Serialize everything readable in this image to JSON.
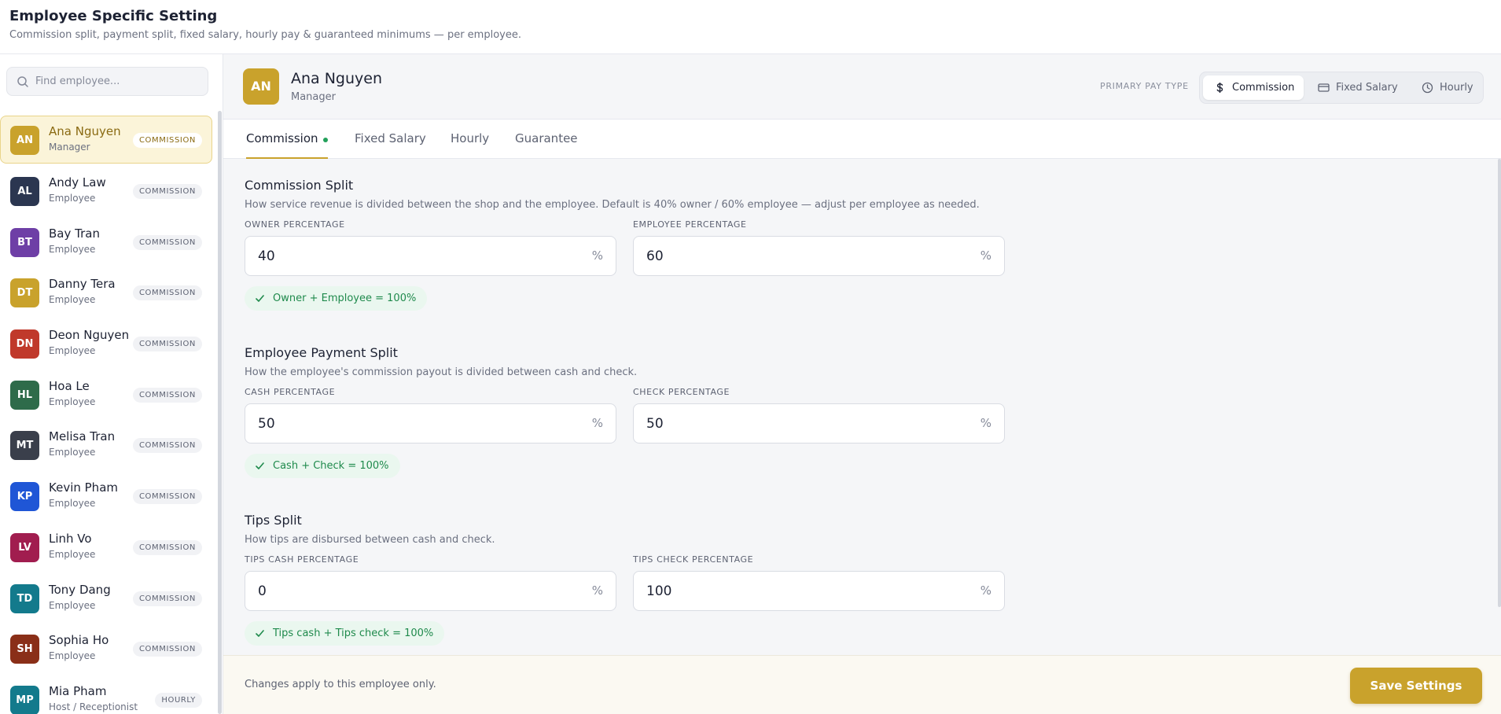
{
  "page": {
    "title": "Employee Specific Setting",
    "subtitle": "Commission split, payment split, fixed salary, hourly pay & guaranteed minimums — per employee."
  },
  "sidebar": {
    "search_placeholder": "Find employee...",
    "employees": [
      {
        "initials": "AN",
        "name": "Ana Nguyen",
        "role": "Manager",
        "badge": "COMMISSION",
        "color": "#c9a22c",
        "active": true
      },
      {
        "initials": "AL",
        "name": "Andy Law",
        "role": "Employee",
        "badge": "COMMISSION",
        "color": "#2b3650"
      },
      {
        "initials": "BT",
        "name": "Bay Tran",
        "role": "Employee",
        "badge": "COMMISSION",
        "color": "#6e3fa6"
      },
      {
        "initials": "DT",
        "name": "Danny Tera",
        "role": "Employee",
        "badge": "COMMISSION",
        "color": "#c9a22c"
      },
      {
        "initials": "DN",
        "name": "Deon Nguyen",
        "role": "Employee",
        "badge": "COMMISSION",
        "color": "#c0392b"
      },
      {
        "initials": "HL",
        "name": "Hoa Le",
        "role": "Employee",
        "badge": "COMMISSION",
        "color": "#2e6b4a"
      },
      {
        "initials": "MT",
        "name": "Melisa Tran",
        "role": "Employee",
        "badge": "COMMISSION",
        "color": "#3a3f4b"
      },
      {
        "initials": "KP",
        "name": "Kevin Pham",
        "role": "Employee",
        "badge": "COMMISSION",
        "color": "#1f56d6"
      },
      {
        "initials": "LV",
        "name": "Linh Vo",
        "role": "Employee",
        "badge": "COMMISSION",
        "color": "#a11d4f"
      },
      {
        "initials": "TD",
        "name": "Tony Dang",
        "role": "Employee",
        "badge": "COMMISSION",
        "color": "#137a8c"
      },
      {
        "initials": "SH",
        "name": "Sophia Ho",
        "role": "Employee",
        "badge": "COMMISSION",
        "color": "#8a2f18"
      },
      {
        "initials": "MP",
        "name": "Mia Pham",
        "role": "Host / Receptionist",
        "badge": "HOURLY",
        "color": "#137a8c"
      }
    ]
  },
  "employee": {
    "initials": "AN",
    "name": "Ana Nguyen",
    "role": "Manager"
  },
  "pay_type": {
    "label": "PRIMARY PAY TYPE",
    "options": [
      {
        "label": "Commission",
        "icon": "dollar-icon",
        "active": true
      },
      {
        "label": "Fixed Salary",
        "icon": "card-icon",
        "active": false
      },
      {
        "label": "Hourly",
        "icon": "clock-icon",
        "active": false
      }
    ]
  },
  "tabs": [
    {
      "label": "Commission",
      "active": true
    },
    {
      "label": "Fixed Salary",
      "active": false
    },
    {
      "label": "Hourly",
      "active": false
    },
    {
      "label": "Guarantee",
      "active": false
    }
  ],
  "sections": {
    "commission_split": {
      "title": "Commission Split",
      "desc": "How service revenue is divided between the shop and the employee. Default is 40% owner / 60% employee — adjust per employee as needed.",
      "fields": [
        {
          "label": "OWNER PERCENTAGE",
          "value": "40",
          "unit": "%"
        },
        {
          "label": "EMPLOYEE PERCENTAGE",
          "value": "60",
          "unit": "%"
        }
      ],
      "validation": "Owner + Employee = 100%"
    },
    "payment_split": {
      "title": "Employee Payment Split",
      "desc": "How the employee's commission payout is divided between cash and check.",
      "fields": [
        {
          "label": "CASH PERCENTAGE",
          "value": "50",
          "unit": "%"
        },
        {
          "label": "CHECK PERCENTAGE",
          "value": "50",
          "unit": "%"
        }
      ],
      "validation": "Cash + Check = 100%"
    },
    "tips_split": {
      "title": "Tips Split",
      "desc": "How tips are disbursed between cash and check.",
      "fields": [
        {
          "label": "TIPS CASH PERCENTAGE",
          "value": "0",
          "unit": "%"
        },
        {
          "label": "TIPS CHECK PERCENTAGE",
          "value": "100",
          "unit": "%"
        }
      ],
      "validation": "Tips cash + Tips check = 100%"
    }
  },
  "footer": {
    "note": "Changes apply to this employee only.",
    "save_label": "Save Settings"
  },
  "colors": {
    "accent": "#c9a22c",
    "success": "#1f8a4c"
  }
}
